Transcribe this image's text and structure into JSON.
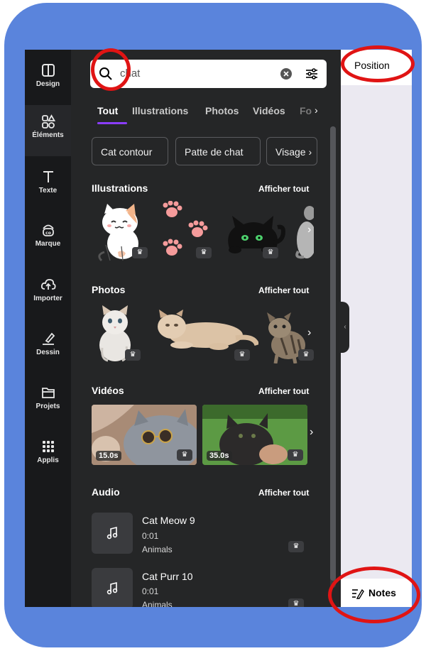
{
  "rail": {
    "items": [
      {
        "label": "Design",
        "icon": "layout-icon"
      },
      {
        "label": "Éléments",
        "icon": "shapes-icon"
      },
      {
        "label": "Texte",
        "icon": "text-icon"
      },
      {
        "label": "Marque",
        "icon": "brand-icon"
      },
      {
        "label": "Importer",
        "icon": "upload-cloud-icon"
      },
      {
        "label": "Dessin",
        "icon": "draw-icon"
      },
      {
        "label": "Projets",
        "icon": "folder-icon"
      },
      {
        "label": "Applis",
        "icon": "apps-grid-icon"
      }
    ]
  },
  "search": {
    "value": "chat"
  },
  "tabs": [
    "Tout",
    "Illustrations",
    "Photos",
    "Vidéos",
    "Fo"
  ],
  "chips": [
    "Cat contour",
    "Patte de chat",
    "Visage"
  ],
  "sections": {
    "illustrations": {
      "title": "Illustrations",
      "link": "Afficher tout"
    },
    "photos": {
      "title": "Photos",
      "link": "Afficher tout"
    },
    "videos": {
      "title": "Vidéos",
      "link": "Afficher tout",
      "durations": [
        "15.0s",
        "35.0s"
      ]
    },
    "audio": {
      "title": "Audio",
      "link": "Afficher tout"
    }
  },
  "audio_items": [
    {
      "title": "Cat Meow 9",
      "duration": "0:01",
      "category": "Animals"
    },
    {
      "title": "Cat Purr 10",
      "duration": "0:01",
      "category": "Animals"
    }
  ],
  "right": {
    "position_label": "Position",
    "notes_label": "Notes"
  },
  "colors": {
    "frame": "#5a84dc",
    "panel": "#252627",
    "rail": "#18191b",
    "accent": "#8b3dff",
    "annotation": "#e01414"
  }
}
